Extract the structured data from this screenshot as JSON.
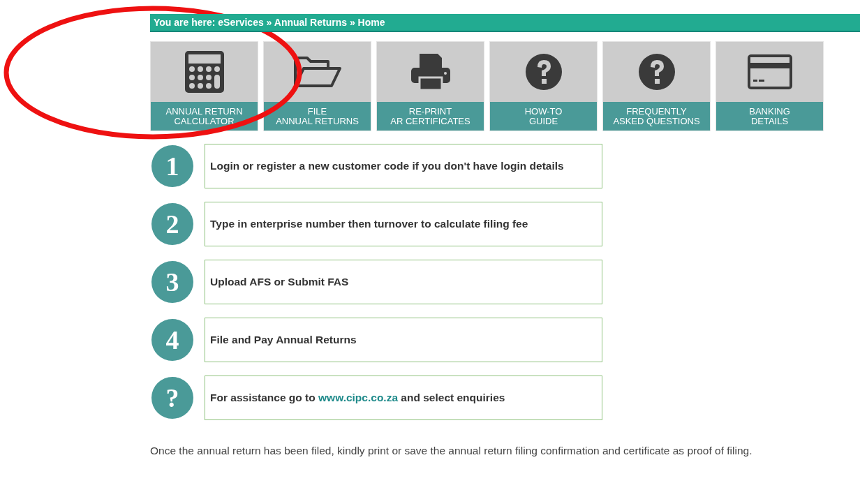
{
  "breadcrumb": "You are here: eServices » Annual Returns » Home",
  "tiles": [
    {
      "line1": "ANNUAL RETURN",
      "line2": "CALCULATOR"
    },
    {
      "line1": "FILE",
      "line2": "ANNUAL RETURNS"
    },
    {
      "line1": "RE-PRINT",
      "line2": "AR CERTIFICATES"
    },
    {
      "line1": "HOW-TO",
      "line2": "GUIDE"
    },
    {
      "line1": "FREQUENTLY",
      "line2": "ASKED QUESTIONS"
    },
    {
      "line1": "BANKING",
      "line2": "DETAILS"
    }
  ],
  "steps": [
    {
      "marker": "1",
      "text": "Login or register a new customer code if you don't have login details"
    },
    {
      "marker": "2",
      "text": "Type in enterprise number then turnover to calculate filing fee"
    },
    {
      "marker": "3",
      "text": "Upload AFS or Submit FAS"
    },
    {
      "marker": "4",
      "text": "File and Pay Annual Returns"
    },
    {
      "marker": "?",
      "text": "For assistance go to ",
      "link": "www.cipc.co.za",
      "text_after": " and select enquiries"
    }
  ],
  "note": "Once the annual return has been filed, kindly print or save the annual return filing confirmation and certificate as proof of filing."
}
